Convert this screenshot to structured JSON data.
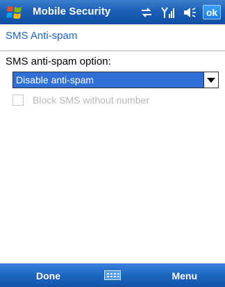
{
  "titlebar": {
    "title": "Mobile Security",
    "ok_label": "ok",
    "icons": [
      "start-flag-icon",
      "connectivity-icon",
      "signal-icon",
      "speaker-icon"
    ]
  },
  "page": {
    "title": "SMS Anti-spam",
    "option_label": "SMS anti-spam option:",
    "dropdown_value": "Disable anti-spam",
    "checkbox_label": "Block SMS without number",
    "checkbox_checked": false
  },
  "softkeys": {
    "left": "Done",
    "right": "Menu",
    "center_icon": "keyboard-icon"
  },
  "colors": {
    "titlebar": "#1b5fb8",
    "accent_text": "#1e63c8",
    "selection": "#2f6fd6",
    "disabled_text": "#b7b7b7"
  }
}
